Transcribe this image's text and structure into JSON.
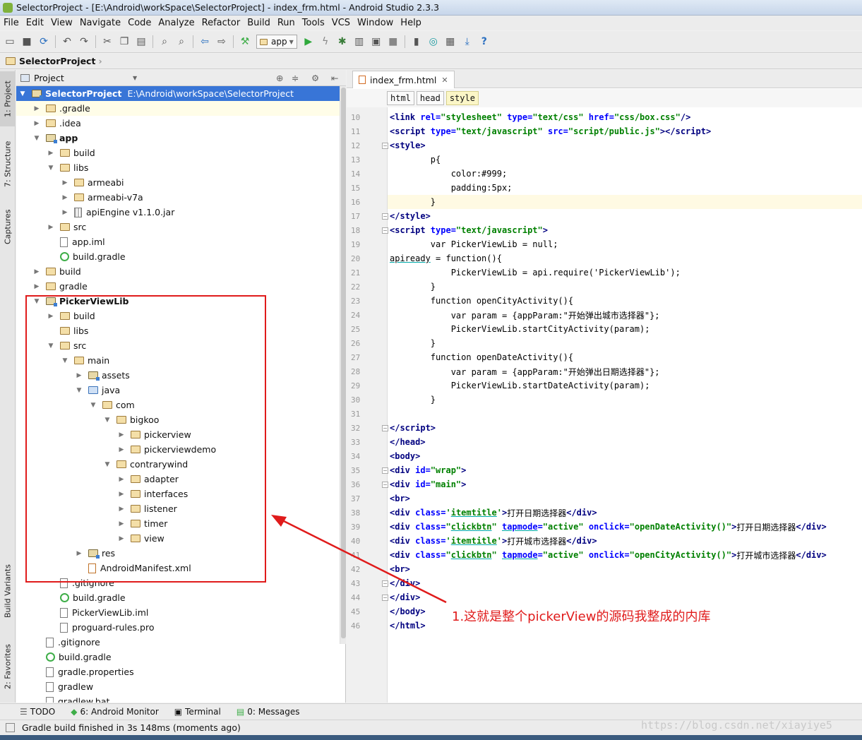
{
  "window": {
    "title": "SelectorProject - [E:\\Android\\workSpace\\SelectorProject] - index_frm.html - Android Studio 2.3.3"
  },
  "menu": [
    "File",
    "Edit",
    "View",
    "Navigate",
    "Code",
    "Analyze",
    "Refactor",
    "Build",
    "Run",
    "Tools",
    "VCS",
    "Window",
    "Help"
  ],
  "toolbar": {
    "run_config": "app",
    "help": "?"
  },
  "navbar": {
    "project": "SelectorProject"
  },
  "side_tabs": {
    "project": "1: Project",
    "structure": "7: Structure",
    "captures": "Captures",
    "build_variants": "Build Variants",
    "favorites": "2: Favorites"
  },
  "project_panel": {
    "view_mode": "Project"
  },
  "tree": [
    {
      "label": "SelectorProject",
      "extra": "E:\\Android\\workSpace\\SelectorProject"
    },
    {
      "label": ".gradle"
    },
    {
      "label": ".idea"
    },
    {
      "label": "app"
    },
    {
      "label": "build"
    },
    {
      "label": "libs"
    },
    {
      "label": "armeabi"
    },
    {
      "label": "armeabi-v7a"
    },
    {
      "label": "apiEngine v1.1.0.jar"
    },
    {
      "label": "src"
    },
    {
      "label": "app.iml"
    },
    {
      "label": "build.gradle"
    },
    {
      "label": "build"
    },
    {
      "label": "gradle"
    },
    {
      "label": "PickerViewLib"
    },
    {
      "label": "build"
    },
    {
      "label": "libs"
    },
    {
      "label": "src"
    },
    {
      "label": "main"
    },
    {
      "label": "assets"
    },
    {
      "label": "java"
    },
    {
      "label": "com"
    },
    {
      "label": "bigkoo"
    },
    {
      "label": "pickerview"
    },
    {
      "label": "pickerviewdemo"
    },
    {
      "label": "contrarywind"
    },
    {
      "label": "adapter"
    },
    {
      "label": "interfaces"
    },
    {
      "label": "listener"
    },
    {
      "label": "timer"
    },
    {
      "label": "view"
    },
    {
      "label": "res"
    },
    {
      "label": "AndroidManifest.xml"
    },
    {
      "label": ".gitignore"
    },
    {
      "label": "build.gradle"
    },
    {
      "label": "PickerViewLib.iml"
    },
    {
      "label": "proguard-rules.pro"
    },
    {
      "label": ".gitignore"
    },
    {
      "label": "build.gradle"
    },
    {
      "label": "gradle.properties"
    },
    {
      "label": "gradlew"
    },
    {
      "label": "gradlew.bat"
    }
  ],
  "editor": {
    "tab": "index_frm.html",
    "breadcrumbs": [
      "html",
      "head",
      "style"
    ],
    "current_line": 16,
    "lines": [
      {
        "n": "10",
        "html": "    <span class='tag'>&lt;link </span><span class='attr'>rel=</span><span class='val'>\"stylesheet\"</span><span class='attr'> type=</span><span class='val'>\"text/css\"</span><span class='attr'> href=</span><span class='val'>\"css/box.css\"</span><span class='tag'>/&gt;</span>"
      },
      {
        "n": "11",
        "html": "    <span class='tag'>&lt;script </span><span class='attr'>type=</span><span class='val'>\"text/javascript\"</span><span class='attr'> src=</span><span class='val'>\"script/public.js\"</span><span class='tag'>&gt;&lt;/script&gt;</span>"
      },
      {
        "n": "12",
        "html": "    <span class='tag'>&lt;style&gt;</span>"
      },
      {
        "n": "13",
        "html": "        p{"
      },
      {
        "n": "14",
        "html": "            color:#999;"
      },
      {
        "n": "15",
        "html": "            padding:5px;"
      },
      {
        "n": "16",
        "html": "        }"
      },
      {
        "n": "17",
        "html": "    <span class='tag'>&lt;/style&gt;</span>"
      },
      {
        "n": "18",
        "html": "    <span class='tag'>&lt;script </span><span class='attr'>type=</span><span class='val'>\"text/javascript\"</span><span class='tag'>&gt;</span>"
      },
      {
        "n": "19",
        "html": "        var PickerViewLib = null;"
      },
      {
        "n": "20",
        "html": "        <span class='und'>apiready</span> = function(){"
      },
      {
        "n": "21",
        "html": "            PickerViewLib = api.require('PickerViewLib');"
      },
      {
        "n": "22",
        "html": "        }"
      },
      {
        "n": "23",
        "html": "        function openCityActivity(){"
      },
      {
        "n": "24",
        "html": "            var param = {appParam:\"开始弹出城市选择器\"};"
      },
      {
        "n": "25",
        "html": "            PickerViewLib.startCityActivity(param);"
      },
      {
        "n": "26",
        "html": "        }"
      },
      {
        "n": "27",
        "html": "        function openDateActivity(){"
      },
      {
        "n": "28",
        "html": "            var param = {appParam:\"开始弹出日期选择器\"};"
      },
      {
        "n": "29",
        "html": "            PickerViewLib.startDateActivity(param);"
      },
      {
        "n": "30",
        "html": "        }"
      },
      {
        "n": "31",
        "html": ""
      },
      {
        "n": "32",
        "html": "    <span class='tag'>&lt;/script&gt;</span>"
      },
      {
        "n": "33",
        "html": "<span class='tag'>&lt;/head&gt;</span>"
      },
      {
        "n": "34",
        "html": "<span class='tag'>&lt;body&gt;</span>"
      },
      {
        "n": "35",
        "html": "<span class='tag'>&lt;div </span><span class='attr'>id=</span><span class='val'>\"wrap\"</span><span class='tag'>&gt;</span>"
      },
      {
        "n": "36",
        "html": "    <span class='tag'>&lt;div </span><span class='attr'>id=</span><span class='val'>\"main\"</span><span class='tag'>&gt;</span>"
      },
      {
        "n": "37",
        "html": "        <span class='tag'>&lt;br&gt;</span>"
      },
      {
        "n": "38",
        "html": "        <span class='tag'>&lt;div </span><span class='attr'>class=</span><span class='val'>'<span class=\"und\">itemtitle</span>'</span><span class='tag'>&gt;</span>打开日期选择器<span class='tag'>&lt;/div&gt;</span>"
      },
      {
        "n": "39",
        "html": "        <span class='tag'>&lt;div </span><span class='attr'>class=</span><span class='val'>\"<span class=\"und\">clickbtn</span>\"</span><span class='attr'> <span class=\"und\">tapmode</span>=</span><span class='val'>\"active\"</span><span class='attr'> onclick=</span><span class='val'>\"openDateActivity()\"</span><span class='tag'>&gt;</span>打开日期选择器<span class='tag'>&lt;/div&gt;</span>"
      },
      {
        "n": "40",
        "html": "        <span class='tag'>&lt;div </span><span class='attr'>class=</span><span class='val'>'<span class=\"und\">itemtitle</span>'</span><span class='tag'>&gt;</span>打开城市选择器<span class='tag'>&lt;/div&gt;</span>"
      },
      {
        "n": "41",
        "html": "        <span class='tag'>&lt;div </span><span class='attr'>class=</span><span class='val'>\"<span class=\"und\">clickbtn</span>\"</span><span class='attr'> <span class=\"und\">tapmode</span>=</span><span class='val'>\"active\"</span><span class='attr'> onclick=</span><span class='val'>\"openCityActivity()\"</span><span class='tag'>&gt;</span>打开城市选择器<span class='tag'>&lt;/div&gt;</span>"
      },
      {
        "n": "42",
        "html": "        <span class='tag'>&lt;br&gt;</span>"
      },
      {
        "n": "43",
        "html": "    <span class='tag'>&lt;/div&gt;</span>"
      },
      {
        "n": "44",
        "html": "<span class='tag'>&lt;/div&gt;</span>"
      },
      {
        "n": "45",
        "html": "<span class='tag'>&lt;/body&gt;</span>"
      },
      {
        "n": "46",
        "html": "<span class='tag'>&lt;/html&gt;</span>"
      }
    ]
  },
  "annotation": "1.这就是整个pickerView的源码我整成的内库",
  "bottom_tabs": [
    {
      "label": "TODO"
    },
    {
      "label": "6: Android Monitor"
    },
    {
      "label": "Terminal"
    },
    {
      "label": "0: Messages"
    }
  ],
  "status": "Gradle build finished in 3s 148ms (moments ago)",
  "watermark": "https://blog.csdn.net/xiayiye5",
  "colors": {
    "selection": "#3875d7",
    "annotation": "#e01b1b",
    "tag": "#000080",
    "attr": "#0000ff",
    "value": "#008000"
  }
}
